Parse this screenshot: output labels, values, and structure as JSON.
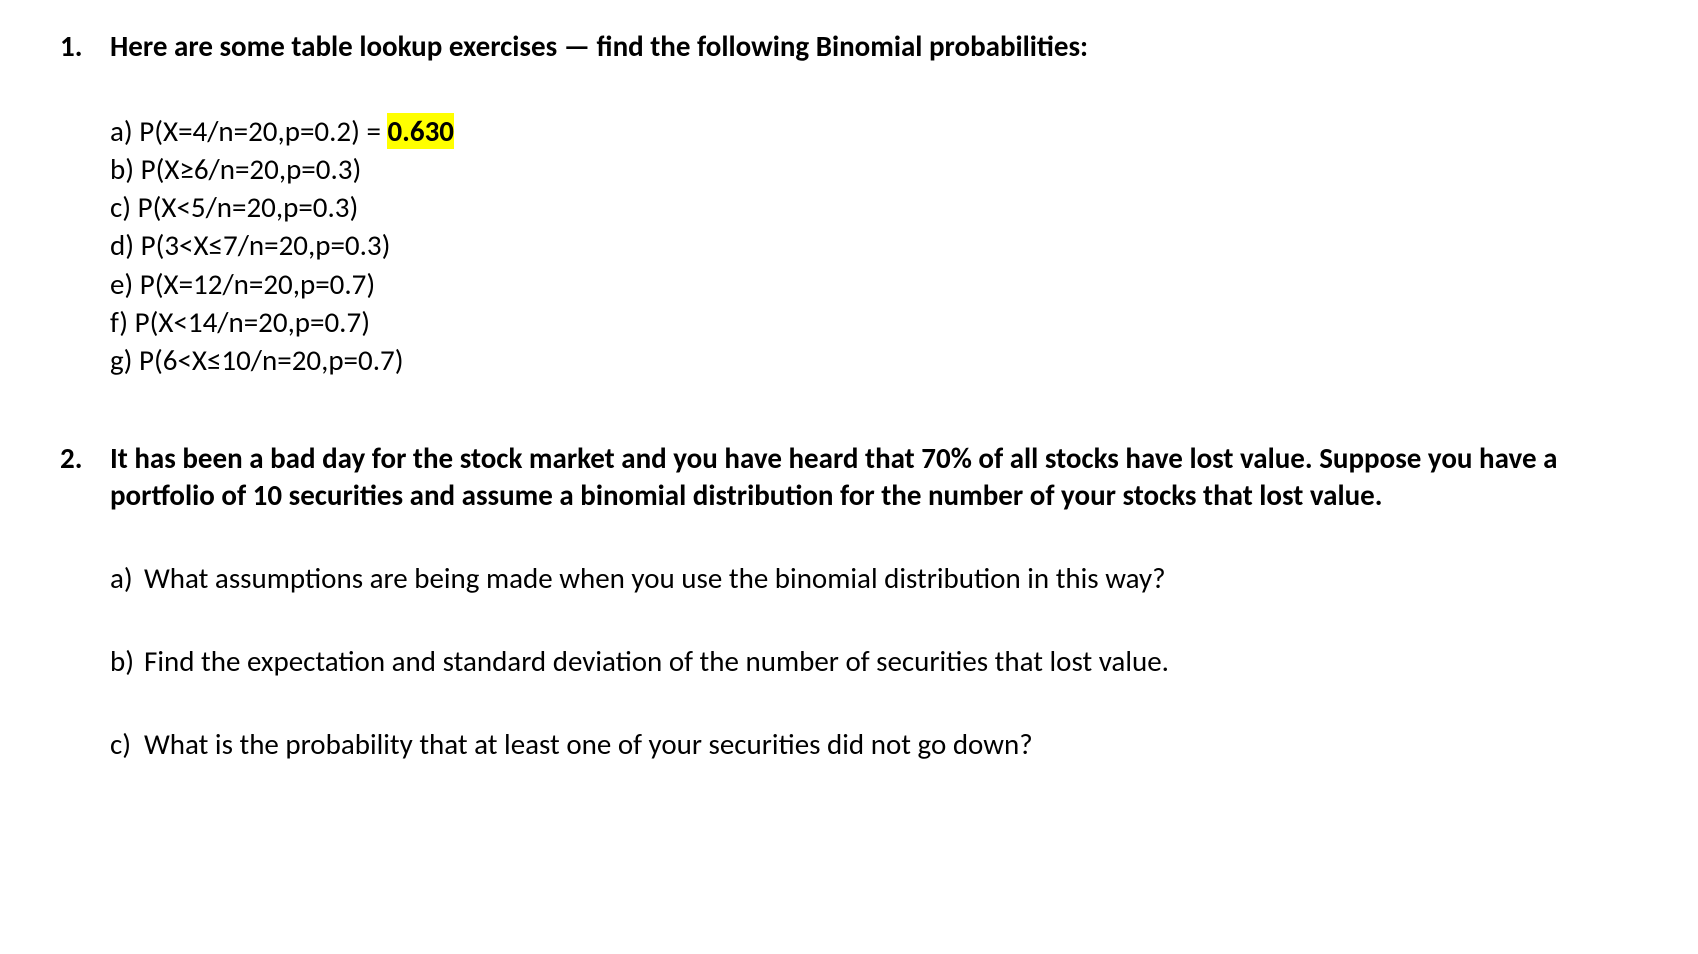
{
  "q1": {
    "number": "1.",
    "title": "Here are some table lookup exercises — find the following Binomial probabilities:",
    "items": {
      "a_pre": "a) P(X=4/n=20,p=0.2) = ",
      "a_hl": "0.630",
      "b": "b) P(X≥6/n=20,p=0.3)",
      "c": "c) P(X<5/n=20,p=0.3)",
      "d": "d) P(3<X≤7/n=20,p=0.3)",
      "e": "e) P(X=12/n=20,p=0.7)",
      "f": "f) P(X<14/n=20,p=0.7)",
      "g": "g) P(6<X≤10/n=20,p=0.7)"
    }
  },
  "q2": {
    "number": "2.",
    "title": "It has been a bad day for the stock market and you have heard that 70% of all stocks have lost value. Suppose you have a portfolio of 10 securities and assume a binomial distribution for the number of your stocks that lost value.",
    "items": {
      "a_label": "a)",
      "a_text": "What assumptions are being made when you use the binomial distribution in this way?",
      "b_label": "b)",
      "b_text": "Find the expectation and standard deviation of the number of securities that lost value.",
      "c_label": "c)",
      "c_text": "What is the probability that at least one of your securities did not go down?"
    }
  }
}
